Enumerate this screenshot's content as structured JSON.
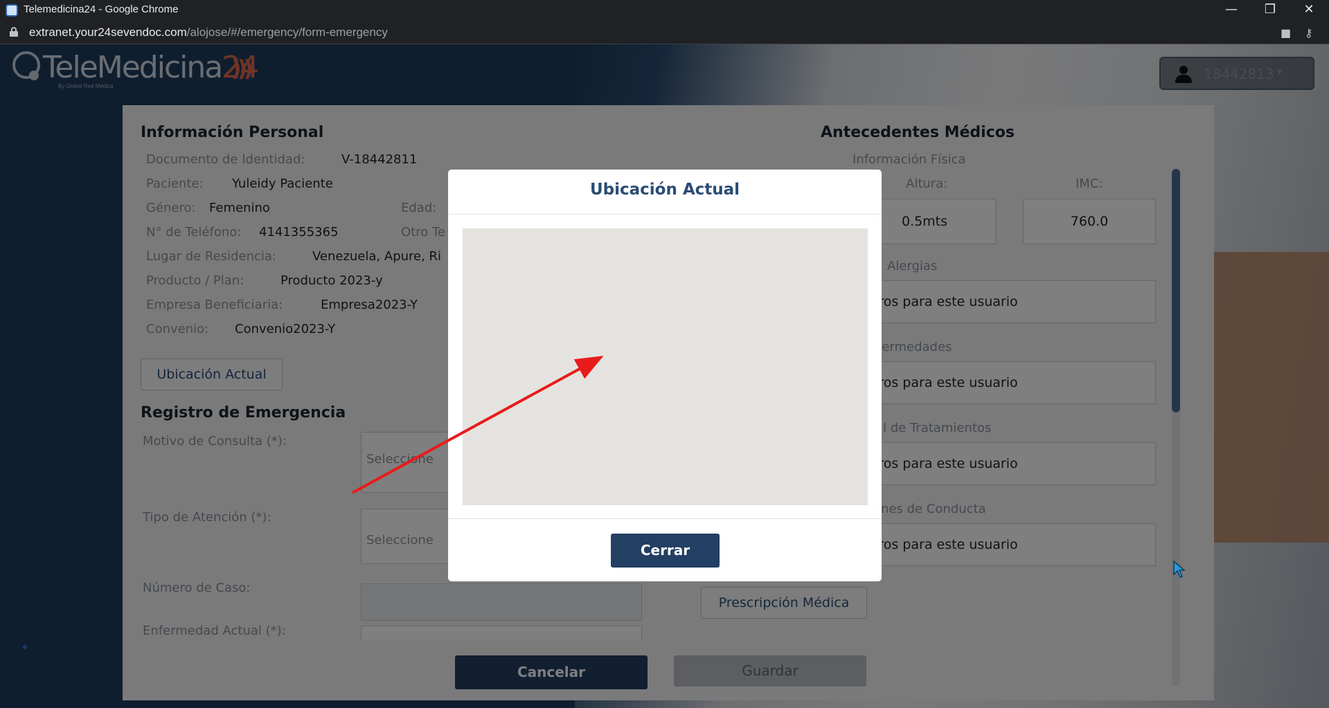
{
  "browser": {
    "tab_title": "Telemedicina24 - Google Chrome",
    "url_host": "extranet.your24sevendoc.com",
    "url_path": "/alojose/#/emergency/form-emergency",
    "window_controls": {
      "minimize": "—",
      "restore": "❐",
      "close": "✕"
    }
  },
  "header": {
    "logo_text": "TeleMedicina",
    "logo_number": "24",
    "logo_waves": ")))",
    "logo_tagline": "By Global Red Médica",
    "user_id": "18442813",
    "user_caret": "▾"
  },
  "personal_info": {
    "title": "Información Personal",
    "rows": [
      {
        "label": "Documento de Identidad:",
        "value": "V-18442811"
      },
      {
        "label": "Paciente:",
        "value": "Yuleidy Paciente"
      },
      {
        "label": "Género:",
        "value": "Femenino"
      },
      {
        "label": "N° de Teléfono:",
        "value": "4141355365"
      },
      {
        "label": "Lugar de Residencia:",
        "value": "Venezuela, Apure, Ri"
      },
      {
        "label": "Producto / Plan:",
        "value": "Producto 2023-y"
      },
      {
        "label": "Empresa Beneficiaria:",
        "value": "Empresa2023-Y"
      },
      {
        "label": "Convenio:",
        "value": "Convenio2023-Y"
      }
    ],
    "age_label": "Edad:",
    "other_phone_label": "Otro Te",
    "location_button": "Ubicación Actual"
  },
  "emergency": {
    "title": "Registro de Emergencia",
    "motivo_label": "Motivo de Consulta (*):",
    "motivo_placeholder": "Seleccione",
    "tipo_label": "Tipo de Atención (*):",
    "tipo_placeholder": "Seleccione",
    "caso_label": "Número de Caso:",
    "enfermedad_label": "Enfermedad Actual (*):",
    "prescription_button": "Prescripción Médica"
  },
  "medical_history": {
    "title": "Antecedentes Médicos",
    "physical_info": "Información Física",
    "height_label": "Altura:",
    "height_value": "0.5mts",
    "imc_label": "IMC:",
    "imc_value": "760.0",
    "sections": [
      {
        "label": "Alergias",
        "value": "stros para este usuario"
      },
      {
        "label": "fermedades",
        "value": "stros para este usuario"
      },
      {
        "label": "l de Tratamientos",
        "value": "stros para este usuario"
      },
      {
        "label": "nes de Conducta",
        "value": "stros para este usuario"
      }
    ]
  },
  "footer": {
    "cancel": "Cancelar",
    "save": "Guardar"
  },
  "modal": {
    "title": "Ubicación Actual",
    "close": "Cerrar"
  },
  "colors": {
    "primary": "#233f63",
    "accent_text": "#2a4c74",
    "annotation_arrow": "#e81b1b"
  }
}
